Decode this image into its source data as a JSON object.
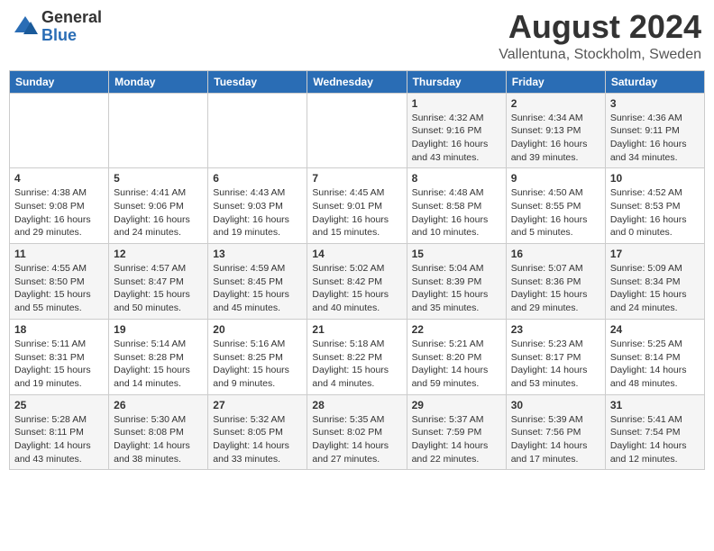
{
  "header": {
    "logo_general": "General",
    "logo_blue": "Blue",
    "month_year": "August 2024",
    "location": "Vallentuna, Stockholm, Sweden"
  },
  "weekdays": [
    "Sunday",
    "Monday",
    "Tuesday",
    "Wednesday",
    "Thursday",
    "Friday",
    "Saturday"
  ],
  "weeks": [
    [
      {
        "day": "",
        "info": ""
      },
      {
        "day": "",
        "info": ""
      },
      {
        "day": "",
        "info": ""
      },
      {
        "day": "",
        "info": ""
      },
      {
        "day": "1",
        "info": "Sunrise: 4:32 AM\nSunset: 9:16 PM\nDaylight: 16 hours\nand 43 minutes."
      },
      {
        "day": "2",
        "info": "Sunrise: 4:34 AM\nSunset: 9:13 PM\nDaylight: 16 hours\nand 39 minutes."
      },
      {
        "day": "3",
        "info": "Sunrise: 4:36 AM\nSunset: 9:11 PM\nDaylight: 16 hours\nand 34 minutes."
      }
    ],
    [
      {
        "day": "4",
        "info": "Sunrise: 4:38 AM\nSunset: 9:08 PM\nDaylight: 16 hours\nand 29 minutes."
      },
      {
        "day": "5",
        "info": "Sunrise: 4:41 AM\nSunset: 9:06 PM\nDaylight: 16 hours\nand 24 minutes."
      },
      {
        "day": "6",
        "info": "Sunrise: 4:43 AM\nSunset: 9:03 PM\nDaylight: 16 hours\nand 19 minutes."
      },
      {
        "day": "7",
        "info": "Sunrise: 4:45 AM\nSunset: 9:01 PM\nDaylight: 16 hours\nand 15 minutes."
      },
      {
        "day": "8",
        "info": "Sunrise: 4:48 AM\nSunset: 8:58 PM\nDaylight: 16 hours\nand 10 minutes."
      },
      {
        "day": "9",
        "info": "Sunrise: 4:50 AM\nSunset: 8:55 PM\nDaylight: 16 hours\nand 5 minutes."
      },
      {
        "day": "10",
        "info": "Sunrise: 4:52 AM\nSunset: 8:53 PM\nDaylight: 16 hours\nand 0 minutes."
      }
    ],
    [
      {
        "day": "11",
        "info": "Sunrise: 4:55 AM\nSunset: 8:50 PM\nDaylight: 15 hours\nand 55 minutes."
      },
      {
        "day": "12",
        "info": "Sunrise: 4:57 AM\nSunset: 8:47 PM\nDaylight: 15 hours\nand 50 minutes."
      },
      {
        "day": "13",
        "info": "Sunrise: 4:59 AM\nSunset: 8:45 PM\nDaylight: 15 hours\nand 45 minutes."
      },
      {
        "day": "14",
        "info": "Sunrise: 5:02 AM\nSunset: 8:42 PM\nDaylight: 15 hours\nand 40 minutes."
      },
      {
        "day": "15",
        "info": "Sunrise: 5:04 AM\nSunset: 8:39 PM\nDaylight: 15 hours\nand 35 minutes."
      },
      {
        "day": "16",
        "info": "Sunrise: 5:07 AM\nSunset: 8:36 PM\nDaylight: 15 hours\nand 29 minutes."
      },
      {
        "day": "17",
        "info": "Sunrise: 5:09 AM\nSunset: 8:34 PM\nDaylight: 15 hours\nand 24 minutes."
      }
    ],
    [
      {
        "day": "18",
        "info": "Sunrise: 5:11 AM\nSunset: 8:31 PM\nDaylight: 15 hours\nand 19 minutes."
      },
      {
        "day": "19",
        "info": "Sunrise: 5:14 AM\nSunset: 8:28 PM\nDaylight: 15 hours\nand 14 minutes."
      },
      {
        "day": "20",
        "info": "Sunrise: 5:16 AM\nSunset: 8:25 PM\nDaylight: 15 hours\nand 9 minutes."
      },
      {
        "day": "21",
        "info": "Sunrise: 5:18 AM\nSunset: 8:22 PM\nDaylight: 15 hours\nand 4 minutes."
      },
      {
        "day": "22",
        "info": "Sunrise: 5:21 AM\nSunset: 8:20 PM\nDaylight: 14 hours\nand 59 minutes."
      },
      {
        "day": "23",
        "info": "Sunrise: 5:23 AM\nSunset: 8:17 PM\nDaylight: 14 hours\nand 53 minutes."
      },
      {
        "day": "24",
        "info": "Sunrise: 5:25 AM\nSunset: 8:14 PM\nDaylight: 14 hours\nand 48 minutes."
      }
    ],
    [
      {
        "day": "25",
        "info": "Sunrise: 5:28 AM\nSunset: 8:11 PM\nDaylight: 14 hours\nand 43 minutes."
      },
      {
        "day": "26",
        "info": "Sunrise: 5:30 AM\nSunset: 8:08 PM\nDaylight: 14 hours\nand 38 minutes."
      },
      {
        "day": "27",
        "info": "Sunrise: 5:32 AM\nSunset: 8:05 PM\nDaylight: 14 hours\nand 33 minutes."
      },
      {
        "day": "28",
        "info": "Sunrise: 5:35 AM\nSunset: 8:02 PM\nDaylight: 14 hours\nand 27 minutes."
      },
      {
        "day": "29",
        "info": "Sunrise: 5:37 AM\nSunset: 7:59 PM\nDaylight: 14 hours\nand 22 minutes."
      },
      {
        "day": "30",
        "info": "Sunrise: 5:39 AM\nSunset: 7:56 PM\nDaylight: 14 hours\nand 17 minutes."
      },
      {
        "day": "31",
        "info": "Sunrise: 5:41 AM\nSunset: 7:54 PM\nDaylight: 14 hours\nand 12 minutes."
      }
    ]
  ]
}
